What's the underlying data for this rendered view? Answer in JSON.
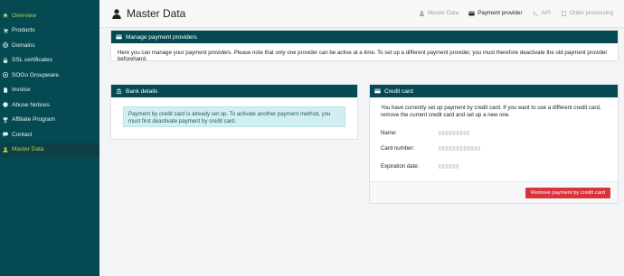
{
  "sidebar": {
    "items": [
      {
        "label": "Overview",
        "icon": "home-icon"
      },
      {
        "label": "Products",
        "icon": "cart-icon"
      },
      {
        "label": "Domains",
        "icon": "globe-icon"
      },
      {
        "label": "SSL certificates",
        "icon": "lock-icon"
      },
      {
        "label": "SOGo Groupware",
        "icon": "groupware-icon"
      },
      {
        "label": "Invoice",
        "icon": "invoice-icon"
      },
      {
        "label": "Abuse Notices",
        "icon": "alert-icon"
      },
      {
        "label": "Affiliate Program",
        "icon": "trophy-icon"
      },
      {
        "label": "Contact",
        "icon": "message-icon"
      },
      {
        "label": "Master Data",
        "icon": "user-icon"
      }
    ]
  },
  "header": {
    "title": "Master Data",
    "tabs": [
      {
        "label": "Master Data",
        "icon": "user-icon"
      },
      {
        "label": "Payment provider",
        "icon": "credit-card-icon"
      },
      {
        "label": "API",
        "icon": "terminal-icon"
      },
      {
        "label": "Order processing",
        "icon": "document-icon"
      }
    ]
  },
  "manage": {
    "title": "Manage payment providers",
    "text": "Here you can manage your payment providers. Please note that only one provider can be active at a time. To set up a different payment provider, you must therefore deactivate the old payment provider beforehand."
  },
  "bank": {
    "title": "Bank details",
    "alert": "Payment by credit card is already set up. To activate another payment method, you must first deactivate payment by credit card."
  },
  "credit_card": {
    "title": "Credit card",
    "intro": "You have currently set up payment by credit card. If you want to use a different credit card, remove the current credit card and set up a new one.",
    "name_label": "Name:",
    "number_label": "Card number:",
    "expiration_label": "Expiration date:",
    "remove_button": "Remove payment by credit card"
  },
  "colors": {
    "sidebar_bg": "#054a53",
    "panel_header": "#054a53",
    "accent_green": "#a7d94a",
    "danger": "#d9343d",
    "alert_bg": "#d3eef0"
  }
}
